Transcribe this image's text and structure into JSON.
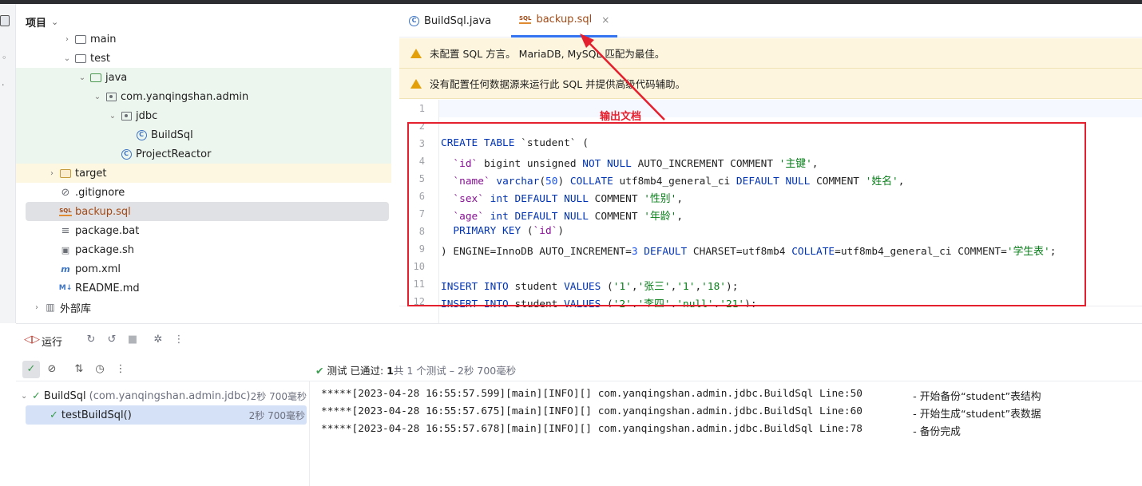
{
  "project": {
    "header": "项目",
    "tree": [
      {
        "label": "main",
        "kind": "folder",
        "indent": 3,
        "arrow": "›"
      },
      {
        "label": "test",
        "kind": "folder",
        "indent": 3,
        "arrow": "⌄"
      },
      {
        "label": "java",
        "kind": "folder-green",
        "indent": 4,
        "arrow": "⌄"
      },
      {
        "label": "com.yanqingshan.admin",
        "kind": "package",
        "indent": 5,
        "arrow": "⌄"
      },
      {
        "label": "jdbc",
        "kind": "package",
        "indent": 6,
        "arrow": "⌄"
      },
      {
        "label": "BuildSql",
        "kind": "class",
        "indent": 7,
        "arrow": ""
      },
      {
        "label": "ProjectReactor",
        "kind": "class",
        "indent": 6,
        "arrow": ""
      },
      {
        "label": "target",
        "kind": "folder-orange",
        "indent": 2,
        "arrow": "›"
      },
      {
        "label": ".gitignore",
        "kind": "ignore",
        "indent": 2,
        "arrow": ""
      },
      {
        "label": "backup.sql",
        "kind": "sql",
        "indent": 2,
        "arrow": ""
      },
      {
        "label": "package.bat",
        "kind": "text",
        "indent": 2,
        "arrow": ""
      },
      {
        "label": "package.sh",
        "kind": "shell",
        "indent": 2,
        "arrow": ""
      },
      {
        "label": "pom.xml",
        "kind": "maven",
        "indent": 2,
        "arrow": ""
      },
      {
        "label": "README.md",
        "kind": "markdown",
        "indent": 2,
        "arrow": ""
      },
      {
        "label": "外部库",
        "kind": "library",
        "indent": 1,
        "arrow": "›"
      }
    ]
  },
  "editor": {
    "tabs": [
      {
        "label": "BuildSql.java",
        "icon": "class-icon"
      },
      {
        "label": "backup.sql",
        "icon": "sql-icon",
        "close": "×"
      }
    ],
    "banner1": "未配置 SQL 方言。 MariaDB, MySQL 匹配为最佳。",
    "banner2": "没有配置任何数据源来运行此 SQL 并提供高级代码辅助。",
    "line_numbers": [
      "1",
      "2",
      "3",
      "4",
      "5",
      "6",
      "7",
      "8",
      "9",
      "10",
      "11",
      "12"
    ]
  },
  "annotations": {
    "output_label": "输出文档"
  },
  "run": {
    "title": "运行",
    "status_passed": "测试 已通过:",
    "status_count": "1",
    "status_rest": "共 1 个测试",
    "status_time": "– 2秒 700毫秒",
    "tests": [
      {
        "name": "BuildSql",
        "detail": "(com.yanqingshan.admin.jdbc)",
        "time": "2秒 700毫秒"
      },
      {
        "name": "testBuildSql()",
        "detail": "",
        "time": "2秒 700毫秒"
      }
    ],
    "console": [
      {
        "log": "*****[2023-04-28 16:55:57.599][main][INFO][] com.yanqingshan.admin.jdbc.BuildSql Line:50",
        "msg": " - 开始备份“student”表结构"
      },
      {
        "log": "*****[2023-04-28 16:55:57.675][main][INFO][] com.yanqingshan.admin.jdbc.BuildSql Line:60",
        "msg": " - 开始生成“student”表数据"
      },
      {
        "log": "*****[2023-04-28 16:55:57.678][main][INFO][] com.yanqingshan.admin.jdbc.BuildSql Line:78",
        "msg": " - 备份完成"
      }
    ]
  },
  "colors": {
    "accent": "#3574f0",
    "annotation_red": "#e5202e",
    "success": "#3a9c4e",
    "warning": "#e3a008"
  },
  "code_lines": [
    [],
    [],
    [
      {
        "t": "CREATE TABLE",
        "c": "kw"
      },
      {
        "t": " `student` ("
      }
    ],
    [
      {
        "t": "  "
      },
      {
        "t": "`id`",
        "c": "bt"
      },
      {
        "t": " bigint unsigned "
      },
      {
        "t": "NOT NULL",
        "c": "kw"
      },
      {
        "t": " AUTO_INCREMENT COMMENT "
      },
      {
        "t": "'主键'",
        "c": "str"
      },
      {
        "t": ","
      }
    ],
    [
      {
        "t": "  "
      },
      {
        "t": "`name`",
        "c": "bt"
      },
      {
        "t": " "
      },
      {
        "t": "varchar",
        "c": "kw"
      },
      {
        "t": "("
      },
      {
        "t": "50",
        "c": "num"
      },
      {
        "t": ") "
      },
      {
        "t": "COLLATE",
        "c": "kw"
      },
      {
        "t": " utf8mb4_general_ci "
      },
      {
        "t": "DEFAULT NULL",
        "c": "kw"
      },
      {
        "t": " COMMENT "
      },
      {
        "t": "'姓名'",
        "c": "str"
      },
      {
        "t": ","
      }
    ],
    [
      {
        "t": "  "
      },
      {
        "t": "`sex`",
        "c": "bt"
      },
      {
        "t": " "
      },
      {
        "t": "int DEFAULT NULL",
        "c": "kw"
      },
      {
        "t": " COMMENT "
      },
      {
        "t": "'性别'",
        "c": "str"
      },
      {
        "t": ","
      }
    ],
    [
      {
        "t": "  "
      },
      {
        "t": "`age`",
        "c": "bt"
      },
      {
        "t": " "
      },
      {
        "t": "int DEFAULT NULL",
        "c": "kw"
      },
      {
        "t": " COMMENT "
      },
      {
        "t": "'年龄'",
        "c": "str"
      },
      {
        "t": ","
      }
    ],
    [
      {
        "t": "  "
      },
      {
        "t": "PRIMARY KEY",
        "c": "kw"
      },
      {
        "t": " ("
      },
      {
        "t": "`id`",
        "c": "bt"
      },
      {
        "t": ")"
      }
    ],
    [
      {
        "t": ") ENGINE=InnoDB AUTO_INCREMENT="
      },
      {
        "t": "3",
        "c": "num"
      },
      {
        "t": " "
      },
      {
        "t": "DEFAULT",
        "c": "kw"
      },
      {
        "t": " CHARSET=utf8mb4 "
      },
      {
        "t": "COLLATE",
        "c": "kw"
      },
      {
        "t": "=utf8mb4_general_ci COMMENT="
      },
      {
        "t": "'学生表'",
        "c": "str"
      },
      {
        "t": ";"
      }
    ],
    [],
    [
      {
        "t": "INSERT INTO",
        "c": "kw"
      },
      {
        "t": " student "
      },
      {
        "t": "VALUES",
        "c": "kw"
      },
      {
        "t": " ("
      },
      {
        "t": "'1'",
        "c": "str"
      },
      {
        "t": ","
      },
      {
        "t": "'张三'",
        "c": "str"
      },
      {
        "t": ","
      },
      {
        "t": "'1'",
        "c": "str"
      },
      {
        "t": ","
      },
      {
        "t": "'18'",
        "c": "str"
      },
      {
        "t": ");"
      }
    ],
    [
      {
        "t": "INSERT INTO",
        "c": "kw"
      },
      {
        "t": " student "
      },
      {
        "t": "VALUES",
        "c": "kw"
      },
      {
        "t": " ("
      },
      {
        "t": "'2'",
        "c": "str"
      },
      {
        "t": ","
      },
      {
        "t": "'李四'",
        "c": "str"
      },
      {
        "t": ","
      },
      {
        "t": "'null'",
        "c": "str"
      },
      {
        "t": ","
      },
      {
        "t": "'21'",
        "c": "str"
      },
      {
        "t": ");"
      }
    ]
  ]
}
